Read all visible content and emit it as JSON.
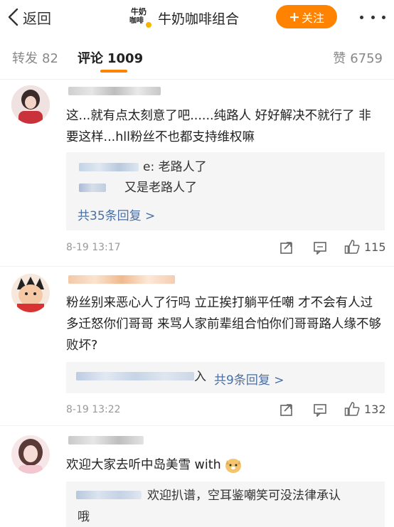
{
  "nav": {
    "back_label": "返回",
    "account_name": "牛奶咖啡组合",
    "logo_line1": "牛奶",
    "logo_line2": "咖啡",
    "follow_label": "关注",
    "follow_plus": "+",
    "accent_color": "#ff8200"
  },
  "tabs": {
    "repost_label": "转发",
    "repost_count": "82",
    "comment_label": "评论",
    "comment_count": "1009",
    "like_label": "赞",
    "like_count": "6759"
  },
  "comments": [
    {
      "text": "这...就有点太刻意了吧......纯路人 好好解决不就行了 非要这样...hll粉丝不也都支持维权嘛",
      "replies": [
        {
          "tail": "e: 老路人了"
        },
        {
          "tail": "又是老路人了"
        }
      ],
      "more_replies": "共35条回复 >",
      "time": "8-19 13:17",
      "likes": "115"
    },
    {
      "text": "粉丝别来恶心人了行吗 立正挨打躺平任嘲 才不会有人过多迁怒你们哥哥 来骂人家前辈组合怕你们哥哥路人缘不够败坏?",
      "reply_tail_char": "入",
      "more_replies": "共9条回复 >",
      "time": "8-19 13:22",
      "likes": "132"
    },
    {
      "text": "欢迎大家去听中岛美雪 with",
      "emoji": "doge-emoji",
      "reply_text": "欢迎扒谱，空耳鉴嘲笑可没法律承认",
      "reply_overflow": "哦"
    }
  ],
  "icons": {
    "back": "chevron-left-icon",
    "more": "more-dots-icon",
    "share": "share-icon",
    "comment": "comment-icon",
    "like": "thumb-up-icon"
  }
}
